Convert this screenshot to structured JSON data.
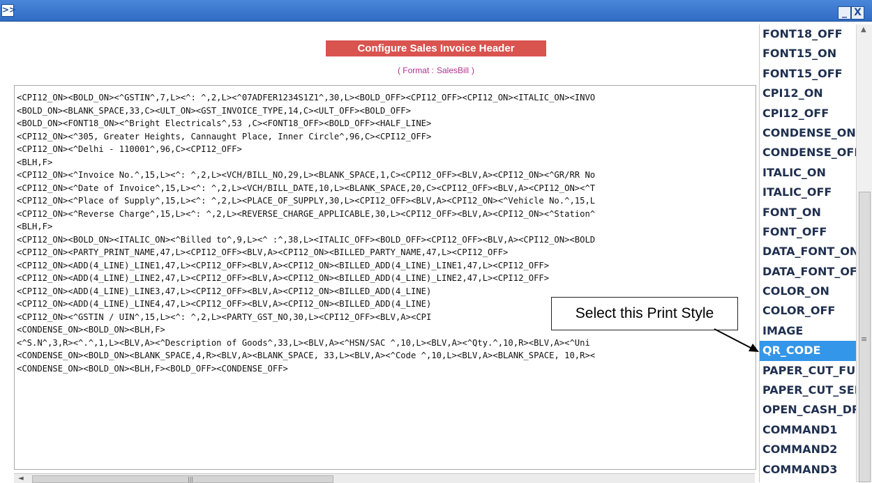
{
  "window": {
    "expand_label": ">>",
    "minimize_label": "_",
    "close_label": "X"
  },
  "header": {
    "title": "Configure Sales Invoice Header",
    "format_prefix": "( Format :",
    "format_value": "SalesBill",
    "format_suffix": ")"
  },
  "editor": {
    "lines": [
      "<CPI12_ON><BOLD_ON><^GSTIN^,7,L><^: ^,2,L><^07ADFER1234S1Z1^,30,L><BOLD_OFF><CPI12_OFF><CPI12_ON><ITALIC_ON><INVO",
      "<BOLD_ON><BLANK_SPACE,33,C><ULT_ON><GST_INVOICE_TYPE,14,C><ULT_OFF><BOLD_OFF>",
      "<BOLD_ON><FONT18_ON><^Bright Electricals^,53 ,C><FONT18_OFF><BOLD_OFF><HALF_LINE>",
      "<CPI12_ON><^305, Greater Heights, Cannaught Place, Inner Circle^,96,C><CPI12_OFF>",
      "<CPI12_ON><^Delhi - 110001^,96,C><CPI12_OFF>",
      "<BLH,F>",
      "<CPI12_ON><^Invoice No.^,15,L><^: ^,2,L><VCH/BILL_NO,29,L><BLANK_SPACE,1,C><CPI12_OFF><BLV,A><CPI12_ON><^GR/RR No",
      "<CPI12_ON><^Date of Invoice^,15,L><^: ^,2,L><VCH/BILL_DATE,10,L><BLANK_SPACE,20,C><CPI12_OFF><BLV,A><CPI12_ON><^T",
      "<CPI12_ON><^Place of Supply^,15,L><^: ^,2,L><PLACE_OF_SUPPLY,30,L><CPI12_OFF><BLV,A><CPI12_ON><^Vehicle No.^,15,L",
      "<CPI12_ON><^Reverse Charge^,15,L><^: ^,2,L><REVERSE_CHARGE_APPLICABLE,30,L><CPI12_OFF><BLV,A><CPI12_ON><^Station^",
      "<BLH,F>",
      "<CPI12_ON><BOLD_ON><ITALIC_ON><^Billed to^,9,L><^ :^,38,L><ITALIC_OFF><BOLD_OFF><CPI12_OFF><BLV,A><CPI12_ON><BOLD",
      "<CPI12_ON><PARTY_PRINT_NAME,47,L><CPI12_OFF><BLV,A><CPI12_ON><BILLED_PARTY_NAME,47,L><CPI12_OFF>",
      "<CPI12_ON><ADD(4_LINE)_LINE1,47,L><CPI12_OFF><BLV,A><CPI12_ON><BILLED_ADD(4_LINE)_LINE1,47,L><CPI12_OFF>",
      "<CPI12_ON><ADD(4_LINE)_LINE2,47,L><CPI12_OFF><BLV,A><CPI12_ON><BILLED_ADD(4_LINE)_LINE2,47,L><CPI12_OFF>",
      "<CPI12_ON><ADD(4_LINE)_LINE3,47,L><CPI12_OFF><BLV,A><CPI12_ON><BILLED_ADD(4_LINE)",
      "<CPI12_ON><ADD(4_LINE)_LINE4,47,L><CPI12_OFF><BLV,A><CPI12_ON><BILLED_ADD(4_LINE)",
      "<CPI12_ON><^GSTIN / UIN^,15,L><^: ^,2,L><PARTY_GST_NO,30,L><CPI12_OFF><BLV,A><CPI",
      "<CONDENSE_ON><BOLD_ON><BLH,F>",
      "<^S.N^,3,R><^.^,1,L><BLV,A><^Description of Goods^,33,L><BLV,A><^HSN/SAC ^,10,L><BLV,A><^Qty.^,10,R><BLV,A><^Uni",
      "<CONDENSE_ON><BOLD_ON><BLANK_SPACE,4,R><BLV,A><BLANK_SPACE, 33,L><BLV,A><^Code ^,10,L><BLV,A><BLANK_SPACE, 10,R><",
      "<CONDENSE_ON><BOLD_ON><BLH,F><BOLD_OFF><CONDENSE_OFF>"
    ]
  },
  "style_list": {
    "items": [
      "FONT18_OFF",
      "FONT15_ON",
      "FONT15_OFF",
      "CPI12_ON",
      "CPI12_OFF",
      "CONDENSE_ON",
      "CONDENSE_OFF",
      "ITALIC_ON",
      "ITALIC_OFF",
      "FONT_ON",
      "FONT_OFF",
      "DATA_FONT_ON",
      "DATA_FONT_OFF",
      "COLOR_ON",
      "COLOR_OFF",
      "IMAGE",
      "QR_CODE",
      "PAPER_CUT_FULL",
      "PAPER_CUT_SEMI",
      "OPEN_CASH_DRAWER",
      "COMMAND1",
      "COMMAND2",
      "COMMAND3"
    ],
    "selected": "QR_CODE"
  },
  "callout": {
    "text": "Select this Print Style"
  },
  "scroll": {
    "up_arrow": "▲",
    "left_arrow": "◄",
    "grip": "≡",
    "hgrip": "|||"
  },
  "colors": {
    "titlebar": "#3a78cc",
    "header_bg": "#d9534f",
    "format_text": "#b0308a",
    "selected_bg": "#3396e8"
  }
}
